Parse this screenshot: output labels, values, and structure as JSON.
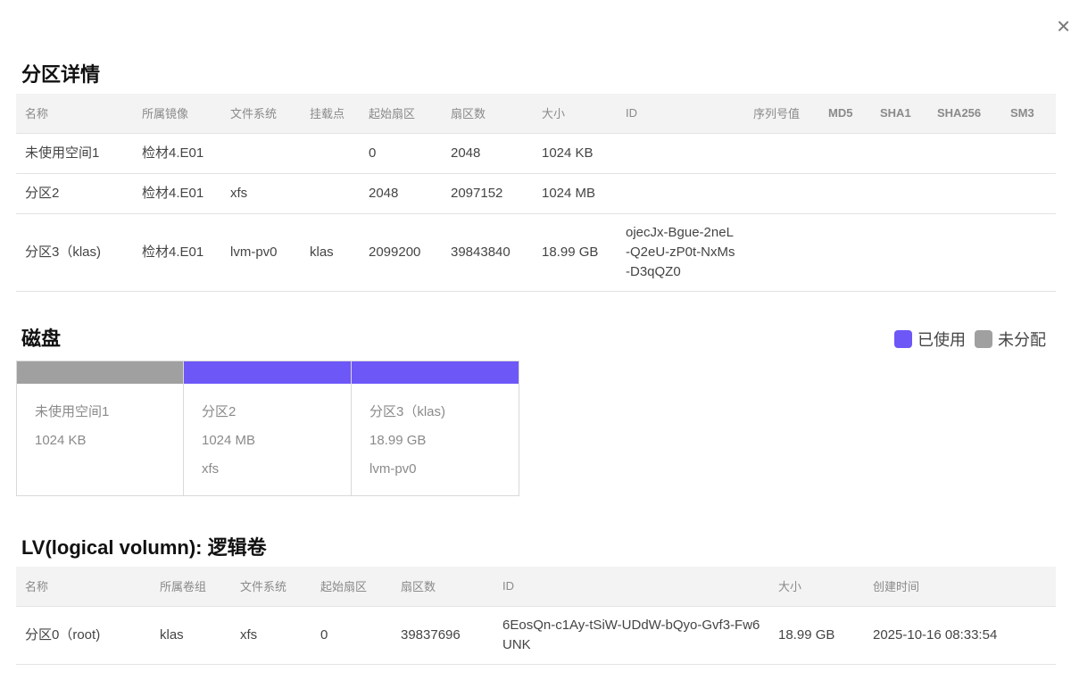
{
  "close_label": "×",
  "partition": {
    "title": "分区详情",
    "headers": [
      "名称",
      "所属镜像",
      "文件系统",
      "挂载点",
      "起始扇区",
      "扇区数",
      "大小",
      "ID",
      "序列号值",
      "MD5",
      "SHA1",
      "SHA256",
      "SM3"
    ],
    "rows": [
      [
        "未使用空间1",
        "检材4.E01",
        "",
        "",
        "0",
        "2048",
        "1024 KB",
        "",
        "",
        "",
        "",
        "",
        ""
      ],
      [
        "分区2",
        "检材4.E01",
        "xfs",
        "",
        "2048",
        "2097152",
        "1024 MB",
        "",
        "",
        "",
        "",
        "",
        ""
      ],
      [
        "分区3（klas)",
        "检材4.E01",
        "lvm-pv0",
        "klas",
        "2099200",
        "39843840",
        "18.99 GB",
        "ojecJx-Bgue-2neL-Q2eU-zP0t-NxMs-D3qQZ0",
        "",
        "",
        "",
        "",
        ""
      ]
    ]
  },
  "disk": {
    "title": "磁盘",
    "legend": [
      {
        "label": "已使用",
        "color": "#6e57f7"
      },
      {
        "label": "未分配",
        "color": "#a0a0a0"
      }
    ],
    "blocks": [
      {
        "name": "未使用空间1",
        "size": "1024 KB",
        "fs": "",
        "bar_color": "#a0a0a0"
      },
      {
        "name": "分区2",
        "size": "1024 MB",
        "fs": "xfs",
        "bar_color": "#6e57f7"
      },
      {
        "name": "分区3（klas)",
        "size": "18.99 GB",
        "fs": "lvm-pv0",
        "bar_color": "#6e57f7"
      }
    ]
  },
  "lv": {
    "title": "LV(logical volumn): 逻辑卷",
    "headers": [
      "名称",
      "所属卷组",
      "文件系统",
      "起始扇区",
      "扇区数",
      "ID",
      "大小",
      "创建时间"
    ],
    "rows": [
      [
        "分区0（root)",
        "klas",
        "xfs",
        "0",
        "39837696",
        "6EosQn-c1Ay-tSiW-UDdW-bQyo-Gvf3-Fw6UNK",
        "18.99 GB",
        "2025-10-16 08:33:54"
      ]
    ]
  }
}
